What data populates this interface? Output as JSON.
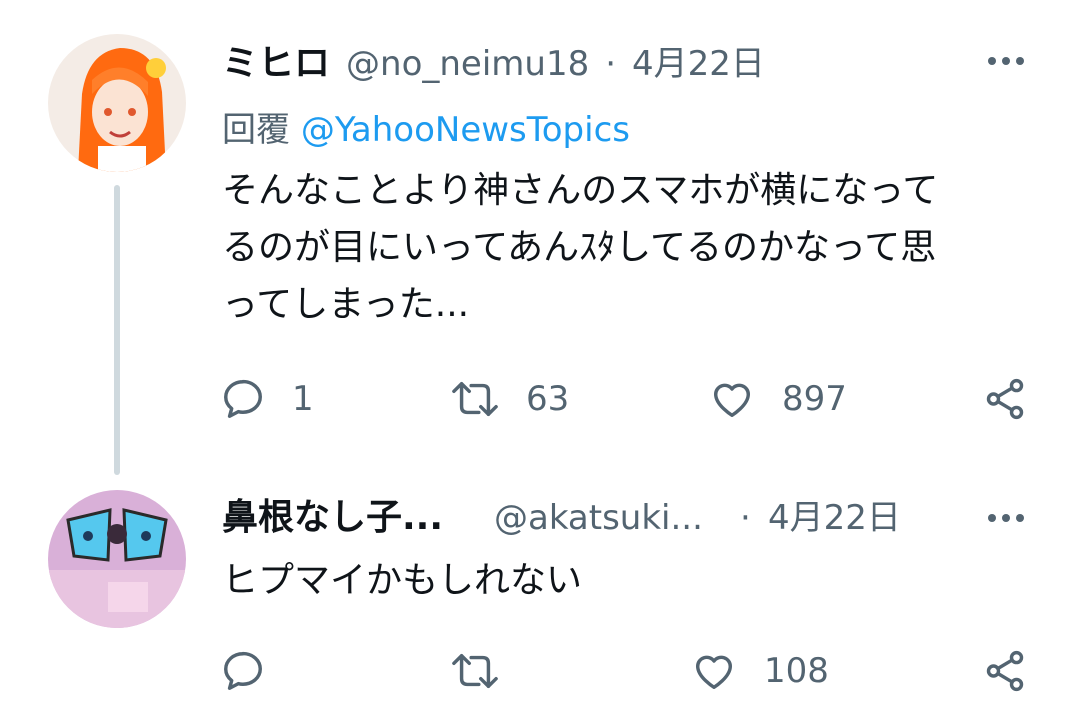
{
  "tweets": [
    {
      "display_name": "ミヒロ",
      "handle": "@no_neimu18",
      "separator": "·",
      "date": "4月22日",
      "reply_label": "回覆",
      "reply_target": "@YahooNewsTopics",
      "text_lines": [
        "そんなことより神さんのスマホが横になって",
        "るのが目にいってあんｽﾀしてるのかなって思",
        "ってしまった..."
      ],
      "replies": "1",
      "retweets": "63",
      "likes": "897",
      "avatar_colors": [
        "#ff7a1a",
        "#f2e7df"
      ]
    },
    {
      "display_name": "鼻根なし子...",
      "handle": "@akatsuki...",
      "separator": "·",
      "date": "4月22日",
      "text_lines": [
        "ヒプマイかもしれない"
      ],
      "replies": "",
      "retweets": "",
      "likes": "108",
      "avatar_colors": [
        "#d9a8d6",
        "#5fc4e8"
      ]
    }
  ],
  "more_label": "•••",
  "icons": [
    "reply-icon",
    "retweet-icon",
    "like-icon",
    "share-icon",
    "more-icon"
  ]
}
